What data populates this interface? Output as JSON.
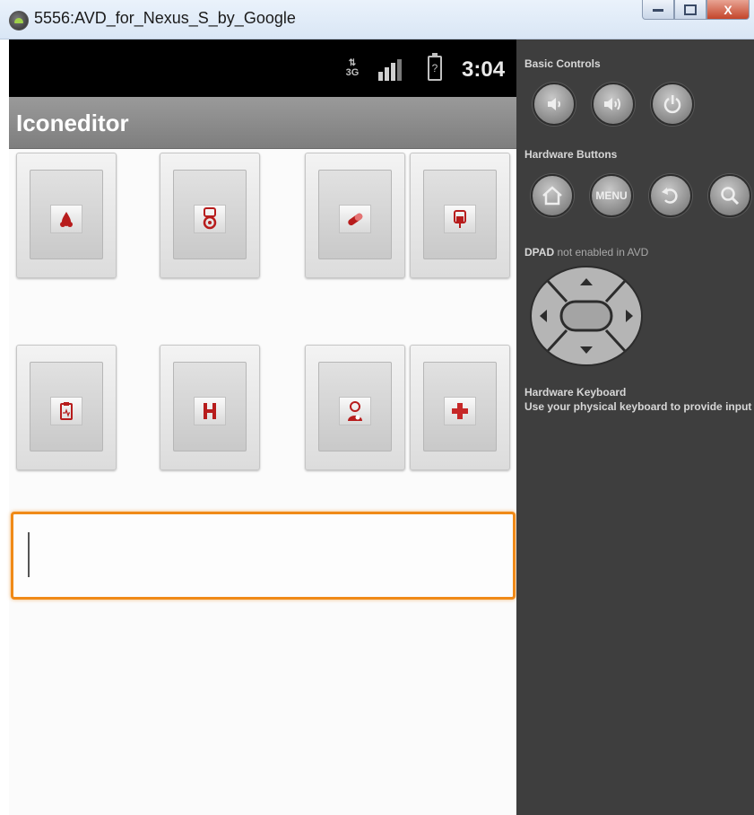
{
  "window": {
    "title": "5556:AVD_for_Nexus_S_by_Google",
    "close_label": "X"
  },
  "status_bar": {
    "network": "3G",
    "battery": "?",
    "time": "3:04"
  },
  "app": {
    "title": "Iconeditor",
    "icon_buttons": [
      {
        "icon": "drops-icon"
      },
      {
        "icon": "stethoscope-icon"
      },
      {
        "icon": "pill-icon"
      },
      {
        "icon": "iv-bag-icon"
      },
      {
        "icon": "clipboard-icon"
      },
      {
        "icon": "hospital-h-icon"
      },
      {
        "icon": "doctor-icon"
      },
      {
        "icon": "medical-cross-icon"
      }
    ],
    "text_field": {
      "value": ""
    },
    "accent_color": "#f08a18",
    "icon_color": "#b71c1c"
  },
  "panel": {
    "basic_controls": "Basic Controls",
    "hardware_buttons": "Hardware Buttons",
    "menu_label": "MENU",
    "dpad_label": "DPAD",
    "dpad_note": "not enabled in AVD",
    "keyboard_title": "Hardware Keyboard",
    "keyboard_note": "Use your physical keyboard to provide input"
  }
}
